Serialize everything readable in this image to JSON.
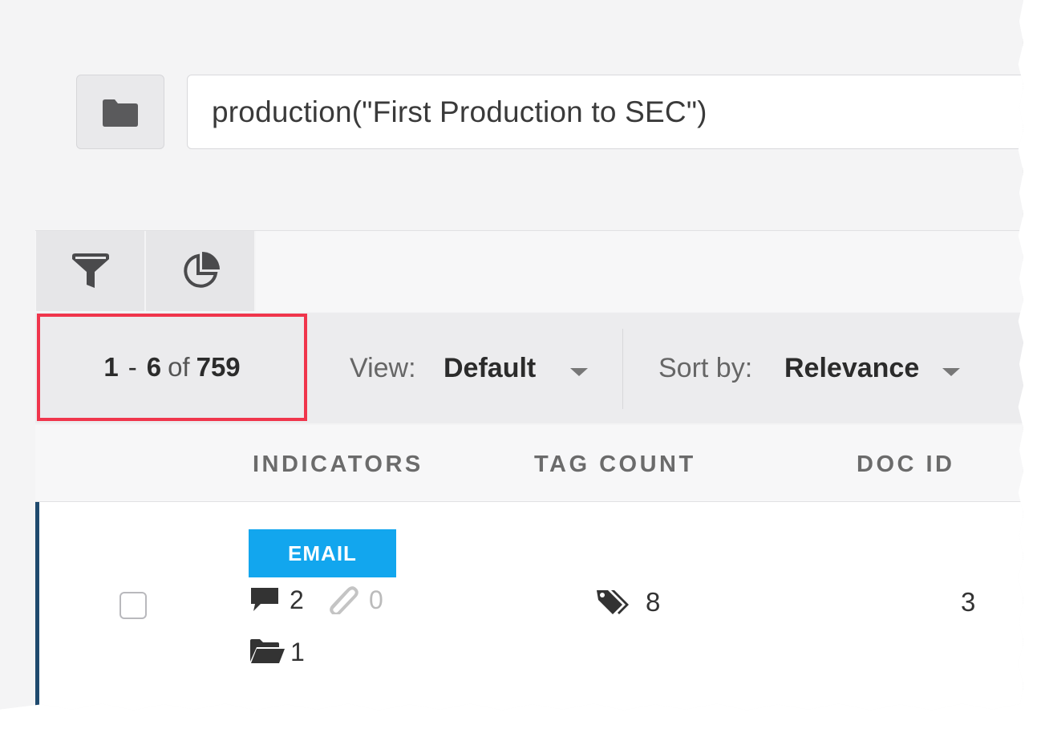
{
  "search": {
    "query": "production(\"First Production to SEC\")"
  },
  "tabs": [
    {
      "icon": "funnel-icon"
    },
    {
      "icon": "pie-chart-icon"
    }
  ],
  "results": {
    "start": "1",
    "dash": "-",
    "end": "6",
    "of": "of",
    "total": "759"
  },
  "view": {
    "label": "View:",
    "value": "Default"
  },
  "sort": {
    "label": "Sort by:",
    "value": "Relevance"
  },
  "columns": {
    "indicators": "INDICATORS",
    "tag_count": "TAG COUNT",
    "doc_id": "DOC ID"
  },
  "rows": [
    {
      "type_badge": "EMAIL",
      "comments": "2",
      "attachments": "0",
      "folders": "1",
      "tag_count": "8",
      "doc_id": "3"
    }
  ],
  "colors": {
    "highlight": "#f0354c",
    "badge": "#12a6ee",
    "row_accent": "#1f4a6e"
  }
}
